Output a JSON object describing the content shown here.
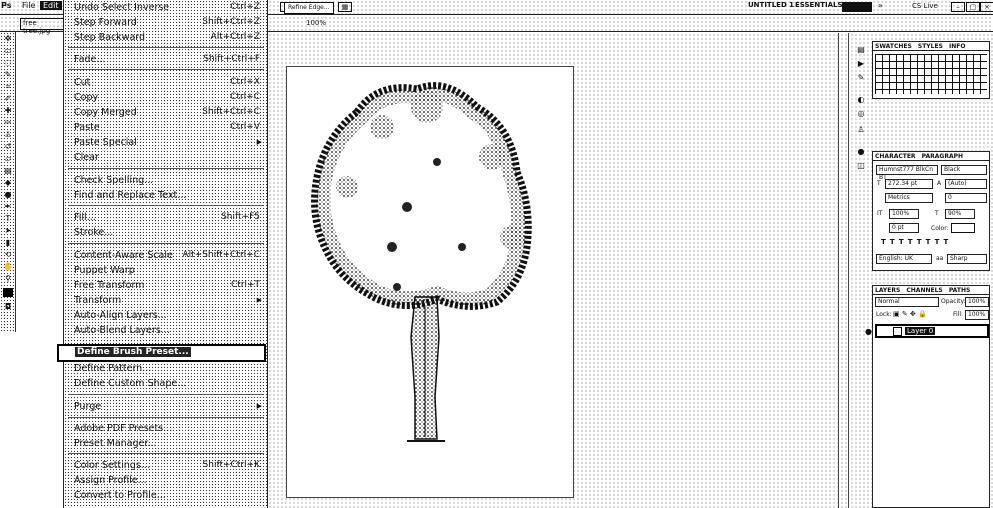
{
  "menubar": {
    "app": "Ps",
    "file": "File",
    "edit": "Edit"
  },
  "topright": {
    "workspace1": "UNTITLED 1",
    "workspace2": "ESSENTIALS",
    "cs_live": "CS Live"
  },
  "options": {
    "doc_tab": "free tree.jpg",
    "zoom": "100%",
    "refine_edge": "Refine Edge..."
  },
  "edit_menu": {
    "items": [
      {
        "label": "Undo Select Inverse",
        "shortcut": "Ctrl+Z"
      },
      {
        "label": "Step Forward",
        "shortcut": "Shift+Ctrl+Z"
      },
      {
        "label": "Step Backward",
        "shortcut": "Alt+Ctrl+Z"
      },
      {
        "label": "Fade...",
        "shortcut": "Shift+Ctrl+F"
      },
      {
        "label": "Cut",
        "shortcut": "Ctrl+X"
      },
      {
        "label": "Copy",
        "shortcut": "Ctrl+C"
      },
      {
        "label": "Copy Merged",
        "shortcut": "Shift+Ctrl+C"
      },
      {
        "label": "Paste",
        "shortcut": "Ctrl+V"
      },
      {
        "label": "Paste Special",
        "shortcut": ""
      },
      {
        "label": "Clear",
        "shortcut": ""
      },
      {
        "label": "Check Spelling...",
        "shortcut": ""
      },
      {
        "label": "Find and Replace Text...",
        "shortcut": ""
      },
      {
        "label": "Fill...",
        "shortcut": "Shift+F5"
      },
      {
        "label": "Stroke...",
        "shortcut": ""
      },
      {
        "label": "Content-Aware Scale",
        "shortcut": "Alt+Shift+Ctrl+C"
      },
      {
        "label": "Puppet Warp",
        "shortcut": ""
      },
      {
        "label": "Free Transform",
        "shortcut": "Ctrl+T"
      },
      {
        "label": "Transform",
        "shortcut": ""
      },
      {
        "label": "Auto-Align Layers...",
        "shortcut": ""
      },
      {
        "label": "Auto-Blend Layers...",
        "shortcut": ""
      },
      {
        "label": "Define Brush Preset...",
        "shortcut": ""
      },
      {
        "label": "Define Pattern...",
        "shortcut": ""
      },
      {
        "label": "Define Custom Shape...",
        "shortcut": ""
      },
      {
        "label": "Purge",
        "shortcut": ""
      },
      {
        "label": "Adobe PDF Presets...",
        "shortcut": ""
      },
      {
        "label": "Preset Manager...",
        "shortcut": ""
      },
      {
        "label": "Color Settings...",
        "shortcut": "Shift+Ctrl+K"
      },
      {
        "label": "Assign Profile...",
        "shortcut": ""
      },
      {
        "label": "Convert to Profile...",
        "shortcut": ""
      }
    ]
  },
  "panels": {
    "swatches_tabs": [
      "SWATCHES",
      "STYLES",
      "INFO"
    ],
    "character_tabs": [
      "CHARACTER",
      "PARAGRAPH"
    ],
    "font_family": "Humnst777 BlkCn BT",
    "font_style": "Black",
    "font_size": "272.34 pt",
    "leading": "(Auto)",
    "kerning": "Metrics",
    "tracking": "0",
    "vscale": "100%",
    "hscale": "90%",
    "baseline": "0 pt",
    "color_label": "Color:",
    "language": "English: UK",
    "antialias": "Sharp",
    "layers_tabs": [
      "LAYERS",
      "CHANNELS",
      "PATHS"
    ],
    "blend_mode": "Normal",
    "opacity_label": "Opacity:",
    "opacity_value": "100%",
    "lock_label": "Lock:",
    "fill_label": "Fill:",
    "fill_value": "100%",
    "layer_name": "Layer 0"
  }
}
